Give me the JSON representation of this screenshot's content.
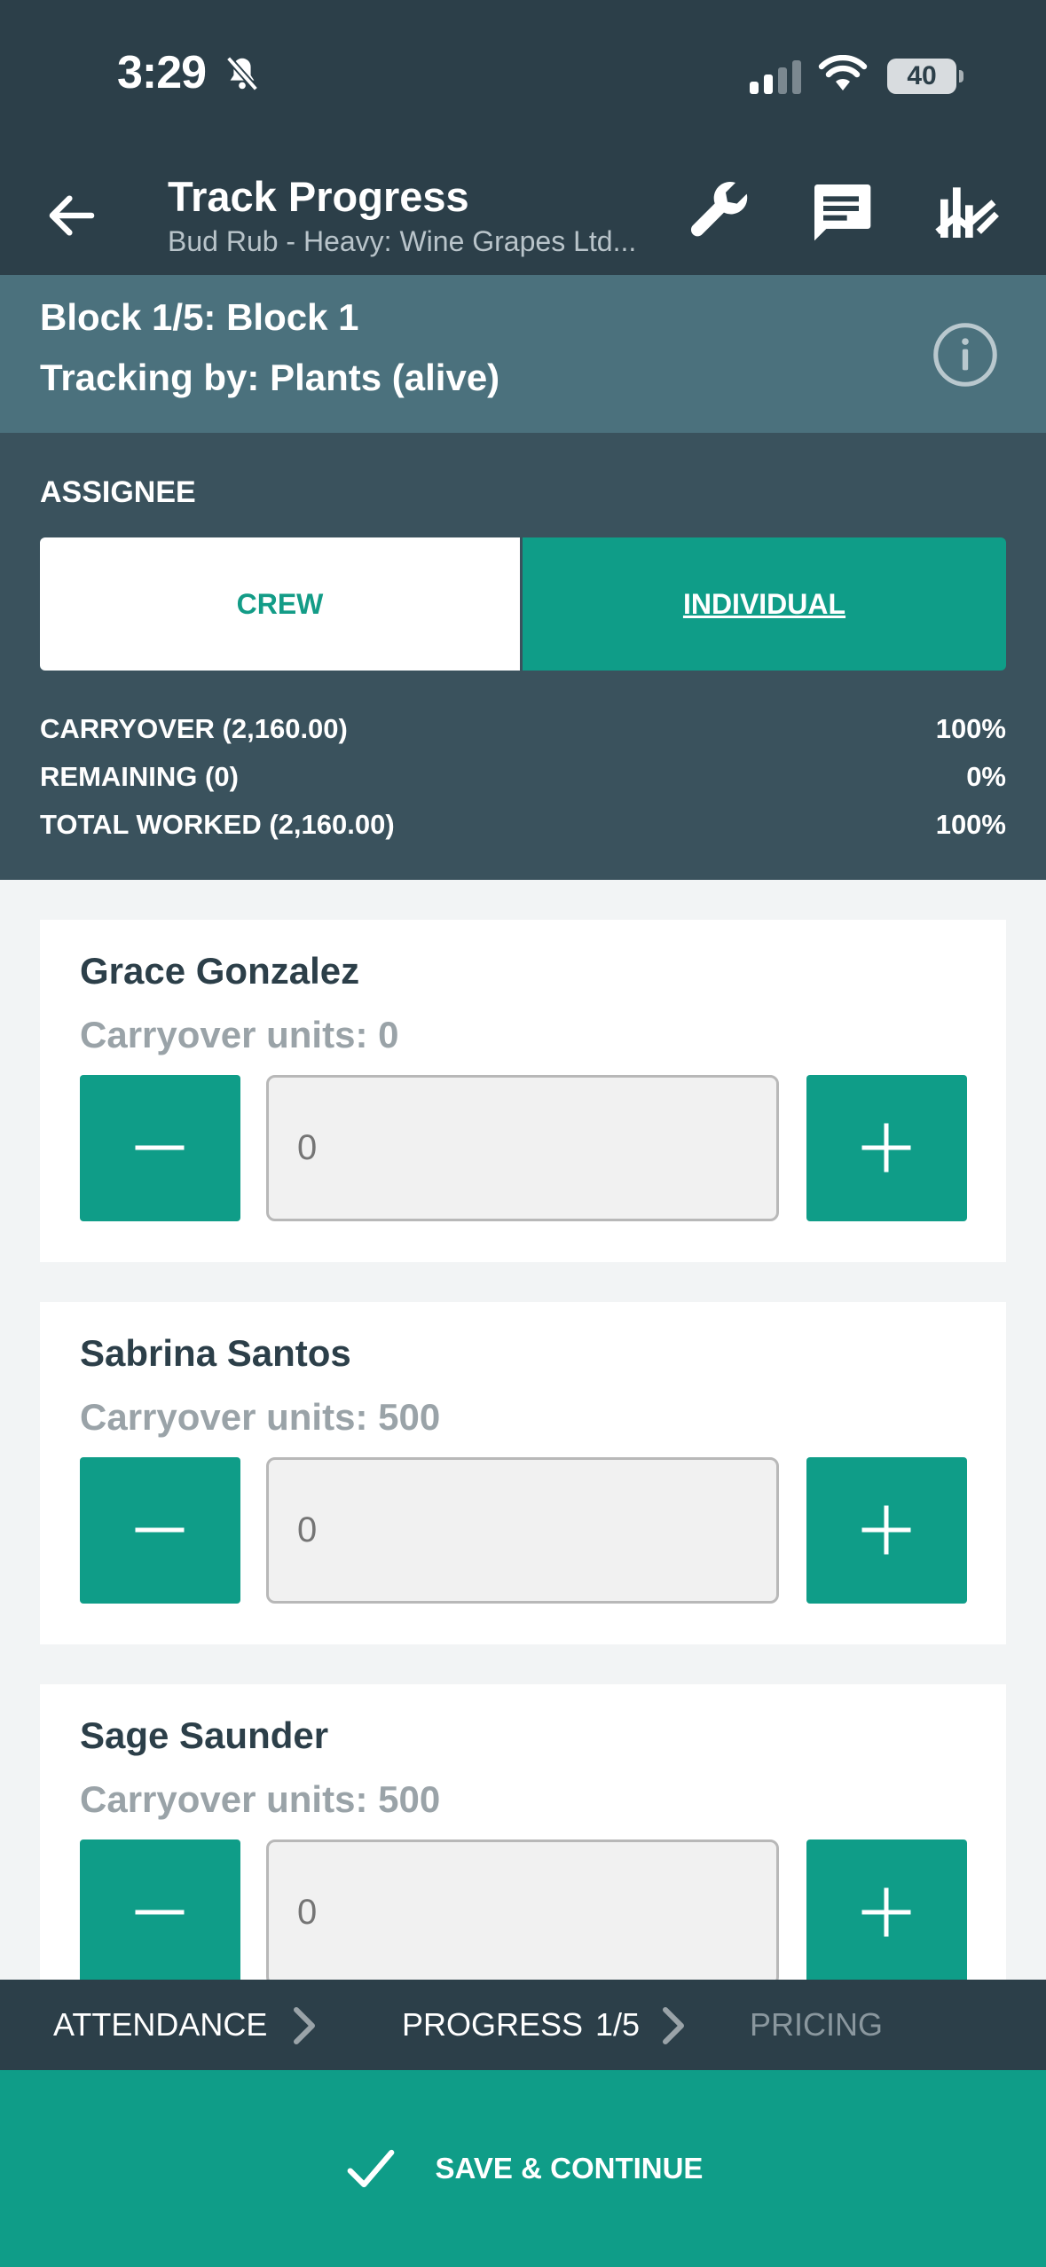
{
  "status_bar": {
    "time": "3:29",
    "battery": "40"
  },
  "header": {
    "title": "Track Progress",
    "subtitle": "Bud Rub - Heavy: Wine Grapes Ltd..."
  },
  "block": {
    "name": "Block 1/5: Block 1",
    "tracking": "Tracking by: Plants (alive)"
  },
  "assignee": {
    "label": "ASSIGNEE",
    "options": [
      "CREW",
      "INDIVIDUAL"
    ],
    "selected": "INDIVIDUAL"
  },
  "stats": [
    {
      "label": "CARRYOVER (2,160.00)",
      "value": "100%"
    },
    {
      "label": "REMAINING (0)",
      "value": "0%"
    },
    {
      "label": "TOTAL WORKED (2,160.00)",
      "value": "100%"
    }
  ],
  "workers": [
    {
      "name": "Grace Gonzalez",
      "carryover": "Carryover units: 0",
      "placeholder": "0"
    },
    {
      "name": "Sabrina Santos",
      "carryover": "Carryover units: 500",
      "placeholder": "0"
    },
    {
      "name": "Sage Saunder",
      "carryover": "Carryover units: 500",
      "placeholder": "0"
    }
  ],
  "steps": {
    "attendance": "ATTENDANCE",
    "progress": "PROGRESS",
    "progress_count": "1/5",
    "pricing": "PRICING"
  },
  "save_label": "SAVE & CONTINUE",
  "colors": {
    "header": "#2c3f49",
    "block_bar": "#4b717d",
    "assignee_bg": "#3a525d",
    "accent": "#0f9d88",
    "muted_text": "#9aa3a8"
  },
  "icons": [
    "bell-slash-icon",
    "signal-icon",
    "wifi-icon",
    "battery-icon",
    "back-arrow-icon",
    "wrench-icon",
    "message-icon",
    "chart-icon",
    "info-icon",
    "minus-icon",
    "plus-icon",
    "chevron-right-icon",
    "check-icon"
  ]
}
